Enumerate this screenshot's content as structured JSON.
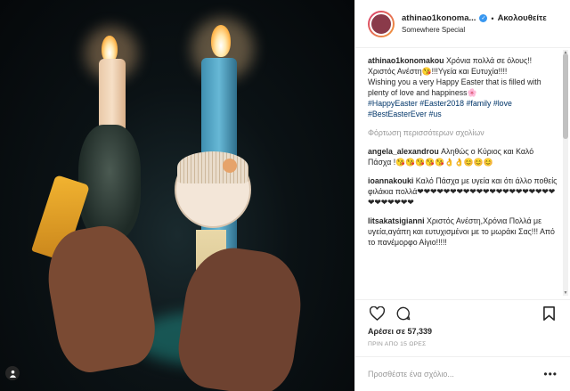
{
  "header": {
    "username": "athinao1konoma...",
    "separator": "•",
    "follow_label": "Ακολουθείτε",
    "location": "Somewhere Special"
  },
  "caption": {
    "username": "athinao1konomakou",
    "text": "Χρόνια πολλά σε όλους!!Χριστός Ανέστη😘!!!Υγεία και Ευτυχία!!!!",
    "text2": "Wishing you a very Happy Easter that is filled with plenty of love and happiness🌸",
    "hashtags": "#HappyEaster #Easter2018 #family #love #BestEasterEver #us"
  },
  "load_more_label": "Φόρτωση περισσότερων σχολίων",
  "comments": [
    {
      "user": "angela_alexandrou",
      "text": "Αληθώς ο Κύριος και Καλό Πάσχα !😘😘😘😘😘👌👌😊😊😊"
    },
    {
      "user": "ioannakouki",
      "text": "Καλό Πάσχα με υγεία και ότι άλλο ποθείς φιλάκια πολλά❤❤❤❤❤❤❤❤❤❤❤❤❤❤❤❤❤❤❤❤❤❤❤❤❤❤❤❤"
    },
    {
      "user": "litsakatsigianni",
      "text": "Χριστός Ανέστη,Χρόνια Πολλά με υγεία,αγάπη και ευτυχισμένοι με το μωράκι Σας!!! Από το πανέμορφο Αίγιο!!!!!"
    }
  ],
  "likes_text": "Αρέσει σε 57,339",
  "time_text": "ΠΡΙΝ ΑΠΟ 15 ΩΡΕΣ",
  "add_comment_placeholder": "Προσθέστε ένα σχόλιο...",
  "more_label": "•••",
  "icons": {
    "like": "heart-icon",
    "comment": "comment-icon",
    "save": "bookmark-icon",
    "media": "person-tag-icon",
    "verified": "verified-badge-icon"
  },
  "colors": {
    "link": "#003569",
    "verified": "#3897f0",
    "muted": "#999999"
  }
}
